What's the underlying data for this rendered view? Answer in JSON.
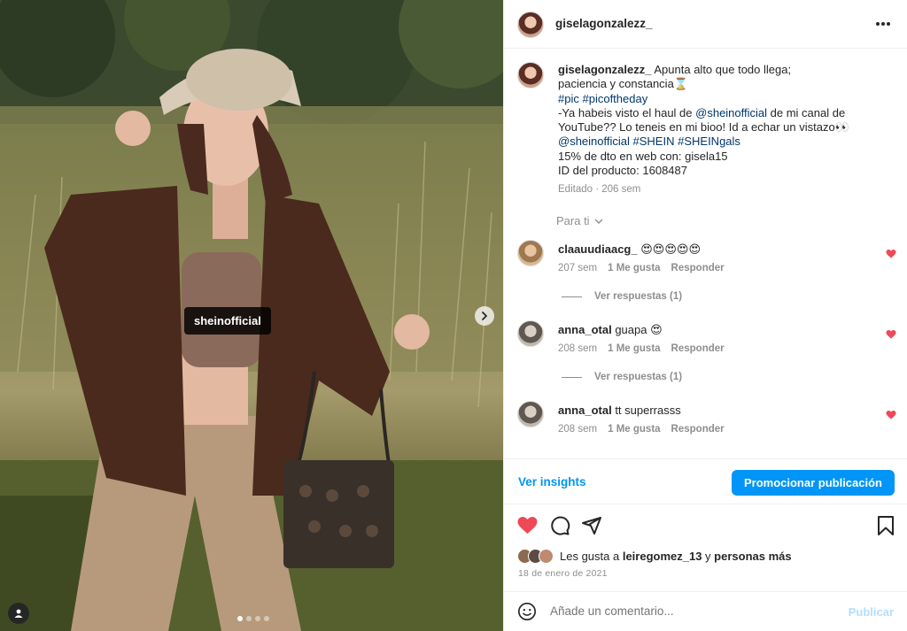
{
  "photo": {
    "tag_label": "sheinofficial",
    "carousel_dots": 4,
    "active_dot": 0
  },
  "header": {
    "username": "giselagonzalezz_"
  },
  "caption": {
    "username": "giselagonzalezz_",
    "lines": [
      "Apunta alto que todo llega;",
      "paciencia y constancia⌛",
      "#pic #picoftheday",
      "-Ya habeis visto el haul de @sheinofficial de mi canal de",
      "YouTube?? Lo teneis en mi bioo! Id a echar un vistazo👀",
      "@sheinofficial #SHEIN #SHEINgals",
      "15% de dto en web con: gisela15",
      "ID del producto: 1608487"
    ],
    "l3_tag1": "#pic",
    "l3_tag2": "#picoftheday",
    "l4_pre": "-Ya habeis visto el haul de ",
    "l4_tag": "@sheinofficial",
    "l4_post": " de mi canal de",
    "l6_tag1": "@sheinofficial",
    "l6_tag2": "#SHEIN",
    "l6_tag3": "#SHEINgals",
    "edited": "Editado · 206 sem",
    "for_you": "Para ti"
  },
  "comments": [
    {
      "username": "claauudiaacg_",
      "text": "😍😍😍😍😍",
      "time": "207 sem",
      "likes": "1 Me gusta",
      "reply": "Responder",
      "replies": "Ver respuestas (1)"
    },
    {
      "username": "anna_otal",
      "text": "guapa 😍",
      "time": "208 sem",
      "likes": "1 Me gusta",
      "reply": "Responder",
      "replies": "Ver respuestas (1)"
    },
    {
      "username": "anna_otal",
      "text": "tt superrasss",
      "time": "208 sem",
      "likes": "1 Me gusta",
      "reply": "Responder"
    }
  ],
  "insights": {
    "link": "Ver insights",
    "promote": "Promocionar publicación"
  },
  "likes": {
    "prefix": "Les gusta a ",
    "user": "leiregomez_13",
    "mid": " y ",
    "others": "personas más"
  },
  "date": "18 de enero de 2021",
  "add_comment": {
    "placeholder": "Añade un comentario...",
    "post": "Publicar"
  },
  "colors": {
    "link_blue": "#0095f6",
    "hashtag": "#00376b",
    "heart_red": "#ed4956",
    "muted": "#8e8e8e"
  },
  "icons": [
    "more-icon",
    "heart-icon",
    "comment-icon",
    "share-icon",
    "bookmark-icon",
    "emoji-icon",
    "chevron-down-icon",
    "chevron-right-icon",
    "tag-user-icon"
  ]
}
